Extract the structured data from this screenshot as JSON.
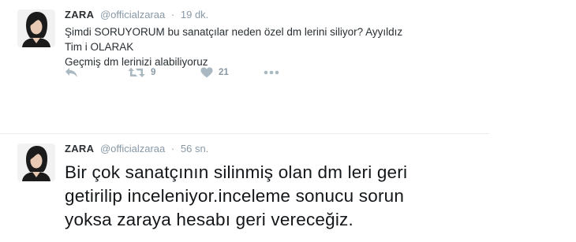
{
  "tweets": [
    {
      "name": "ZARA",
      "handle": "@officialzaraa",
      "separator": "·",
      "time": "19 dk.",
      "text_lines": [
        "Şimdi SORUYORUM  bu sanatçılar neden özel dm lerini siliyor? Ayyıldız Tim i OLARAK",
        "Geçmiş dm lerinizi alabiliyoruz"
      ],
      "actions": {
        "reply_icon": "reply-icon",
        "retweet_icon": "retweet-icon",
        "retweet_count": "9",
        "like_icon": "heart-icon",
        "like_count": "21",
        "more_icon": "more-icon"
      }
    },
    {
      "name": "ZARA",
      "handle": "@officialzaraa",
      "separator": "·",
      "time": "56 sn.",
      "text_lines": [
        "Bir çok sanatçının silinmiş olan dm leri geri",
        "getirilip inceleniyor.inceleme sonucu  sorun",
        "yoksa zaraya  hesabı geri vereceğiz."
      ]
    }
  ],
  "colors": {
    "text": "#292f33",
    "muted": "#8899a6",
    "icon": "#aab8c2",
    "divider": "#e9ecee"
  }
}
